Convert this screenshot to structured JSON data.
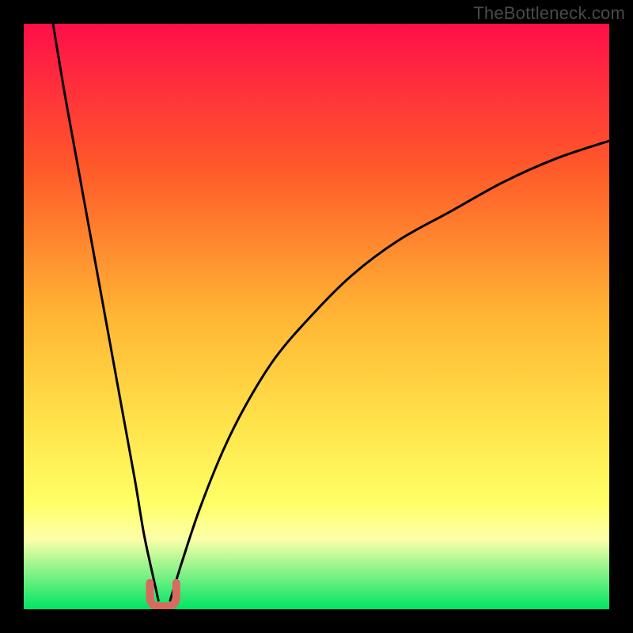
{
  "watermark": "TheBottleneck.com",
  "colors": {
    "frame": "#000000",
    "curve": "#000000",
    "marker_fill": "#d66b60",
    "gradient_top": "#ff0f49",
    "gradient_upper_mid": "#ff5a29",
    "gradient_mid": "#ffb634",
    "gradient_lower_mid": "#ffe24a",
    "gradient_low": "#ffff66",
    "gradient_pale_band": "#fdffa9",
    "gradient_bottom": "#00e463"
  },
  "chart_data": {
    "type": "line",
    "title": "",
    "xlabel": "",
    "ylabel": "",
    "xlim": [
      0,
      100
    ],
    "ylim": [
      0,
      100
    ],
    "notes": "Bottleneck-style plot: vertical gradient from red (top, high bottleneck) through orange/yellow to green (bottom, 0% bottleneck). Two black curves descend to a common minimum near x≈23. Left curve starts near (5,100) and is steep; right curve rises toward ~(100,80). A small rounded marker sits at the minimum.",
    "series": [
      {
        "name": "left-curve",
        "x": [
          5,
          7,
          9,
          11,
          13,
          15,
          17,
          19,
          20.5,
          22,
          23
        ],
        "y": [
          100,
          88,
          77,
          66,
          55,
          44,
          33,
          22,
          13,
          6,
          1.5
        ]
      },
      {
        "name": "right-curve",
        "x": [
          25,
          27,
          30,
          34,
          38,
          43,
          49,
          56,
          64,
          73,
          82,
          91,
          100
        ],
        "y": [
          1.5,
          8,
          17,
          27,
          35,
          43,
          50,
          57,
          63,
          68,
          73,
          77,
          80
        ]
      }
    ],
    "marker": {
      "x_center": 23.8,
      "width": 4.5,
      "y_base": 0.5,
      "height": 4.0
    },
    "gradient_stops_pct": [
      0,
      25,
      50,
      68,
      82,
      88,
      100
    ]
  }
}
